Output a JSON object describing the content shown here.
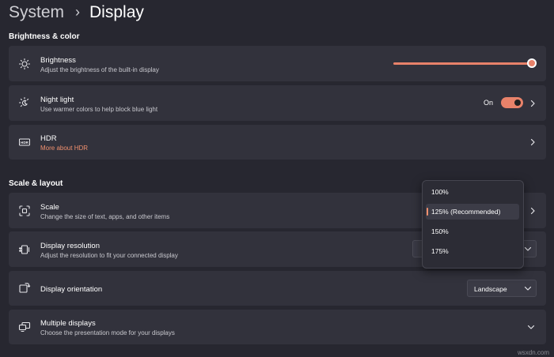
{
  "breadcrumb": {
    "root": "System",
    "separator": "›",
    "page": "Display"
  },
  "sections": {
    "brightness_color": "Brightness & color",
    "scale_layout": "Scale & layout"
  },
  "brightness": {
    "title": "Brightness",
    "desc": "Adjust the brightness of the built-in display",
    "level": 1.0
  },
  "night_light": {
    "title": "Night light",
    "desc": "Use warmer colors to help block blue light",
    "state": "On"
  },
  "hdr": {
    "title": "HDR",
    "link": "More about HDR"
  },
  "scale": {
    "title": "Scale",
    "desc": "Change the size of text, apps, and other items",
    "options": [
      "100%",
      "125% (Recommended)",
      "150%",
      "175%"
    ],
    "selected": "125% (Recommended)"
  },
  "resolution": {
    "title": "Display resolution",
    "desc": "Adjust the resolution to fit your connected display"
  },
  "orientation": {
    "title": "Display orientation",
    "value": "Landscape"
  },
  "multiple": {
    "title": "Multiple displays",
    "desc": "Choose the presentation mode for your displays"
  },
  "watermark": "wsxdn.com",
  "colors": {
    "accent": "#e8826a",
    "link": "#f0906e",
    "background": "#272730",
    "card": "#32323c"
  },
  "icons": [
    "chevron-right-icon",
    "sun-icon",
    "night-light-icon",
    "hdr-icon",
    "scale-icon",
    "resolution-icon",
    "orientation-icon",
    "multiple-displays-icon",
    "chevron-down-icon"
  ]
}
